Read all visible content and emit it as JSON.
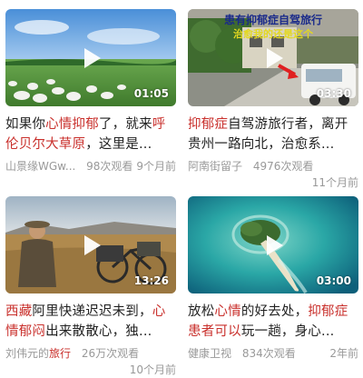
{
  "cards": [
    {
      "duration": "01:05",
      "title_parts": [
        "如果你",
        "心情抑郁",
        "了，就来",
        "呼伦贝尔大草原",
        "，这里是..."
      ],
      "source": "山景缘WGw...",
      "views": "98次观看",
      "time": "9个月前"
    },
    {
      "duration": "03:30",
      "overlay_line1": "患有抑郁症自驾旅行",
      "overlay_line2": "治愈我的还是这个",
      "title_parts": [
        "抑郁症",
        "自驾游旅行者，离开贵州一路向北，治愈系..."
      ],
      "source": "阿南街留子",
      "views": "4976次观看",
      "time": "11个月前"
    },
    {
      "duration": "13:26",
      "title_parts": [
        "西藏",
        "阿里快递迟迟未到，",
        "心情郁闷",
        "出来散散心，独..."
      ],
      "source_parts": [
        "刘伟元的",
        "旅行"
      ],
      "views": "26万次观看",
      "time": "10个月前"
    },
    {
      "duration": "03:00",
      "title_parts": [
        "放松",
        "心情",
        "的好去处，",
        "抑郁症患者可以",
        "玩一趟，身心..."
      ],
      "source": "健康卫视",
      "views": "834次观看",
      "time": "2年前"
    }
  ]
}
